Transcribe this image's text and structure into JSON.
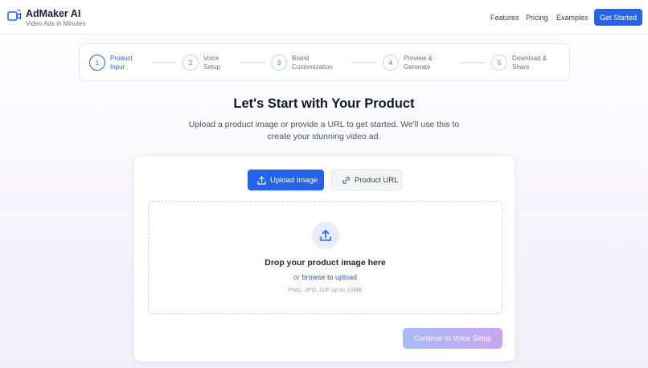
{
  "header": {
    "brand_name": "AdMaker AI",
    "tagline": "Video Ads in Minutes",
    "nav": [
      "Features",
      "Pricing",
      "Examples"
    ],
    "cta": "Get Started",
    "accent_color": "#2563eb"
  },
  "stepper": {
    "active_step": 1,
    "steps": [
      {
        "number": "1",
        "line1": "Product",
        "line2": "Input"
      },
      {
        "number": "2",
        "line1": "Voice",
        "line2": "Setup"
      },
      {
        "number": "3",
        "line1": "Brand",
        "line2": "Customization"
      },
      {
        "number": "4",
        "line1": "Preview &",
        "line2": "Generate"
      },
      {
        "number": "5",
        "line1": "Download &",
        "line2": "Share"
      }
    ]
  },
  "main": {
    "title": "Let's Start with Your Product",
    "subtitle": "Upload a product image or provide a URL to get started. We'll use this to create your stunning video ad."
  },
  "card": {
    "tabs": {
      "upload": "Upload Image",
      "url": "Product URL"
    },
    "dropzone": {
      "title": "Drop your product image here",
      "or": "or",
      "browse": "browse to upload",
      "hint": "PNG, JPG, GIF up to 10MB"
    },
    "continue": "Continue to Voice Setup"
  },
  "icons": [
    "video-camera-icon",
    "upload-icon",
    "link-icon"
  ]
}
